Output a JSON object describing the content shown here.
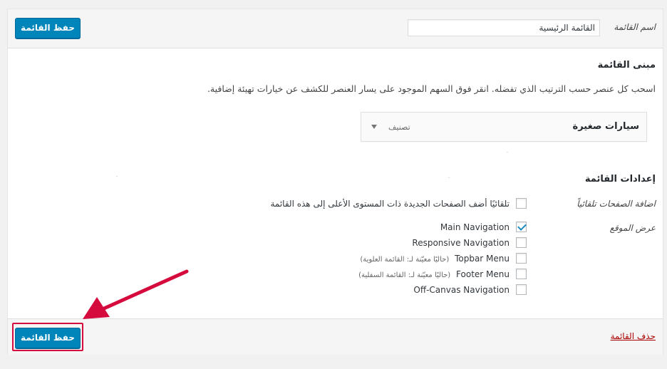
{
  "header": {
    "save_label": "حفظ القائمة",
    "name_label": "اسم القائمة",
    "name_value": "القائمة الرئيسية"
  },
  "structure": {
    "title": "مبنى القائمة",
    "instructions": "اسحب كل عنصر حسب الترتيب الذي تفضله. انقر فوق السهم الموجود على يسار العنصر للكشف عن خيارات تهيئة إضافية.",
    "items": [
      {
        "title": "سيارات صغيرة",
        "type": "تصنيف"
      }
    ]
  },
  "settings": {
    "title": "إعدادات القائمة",
    "auto_add_label": "اضافة الصفحات تلقائياً",
    "auto_add_text": "تلقائيًا أضف الصفحات الجديدة ذات المستوى الأعلى إلى هذه القائمة",
    "auto_add_checked": false,
    "display_location_label": "عرض الموقع",
    "locations": [
      {
        "name": "Main Navigation",
        "note": "",
        "checked": true
      },
      {
        "name": "Responsive Navigation",
        "note": "",
        "checked": false
      },
      {
        "name": "Topbar Menu",
        "note": "(حاليًا معيّنة لـ: القائمة العلوية)",
        "checked": false
      },
      {
        "name": "Footer Menu",
        "note": "(حاليًا معيّنة لـ: القائمة السفلية)",
        "checked": false
      },
      {
        "name": "Off-Canvas Navigation",
        "note": "",
        "checked": false
      }
    ]
  },
  "footer": {
    "delete_label": "حذف القائمة",
    "save_label": "حفظ القائمة"
  },
  "colors": {
    "primary_button": "#0085ba",
    "highlight": "#d50a3d",
    "delete_link": "#a00000"
  }
}
